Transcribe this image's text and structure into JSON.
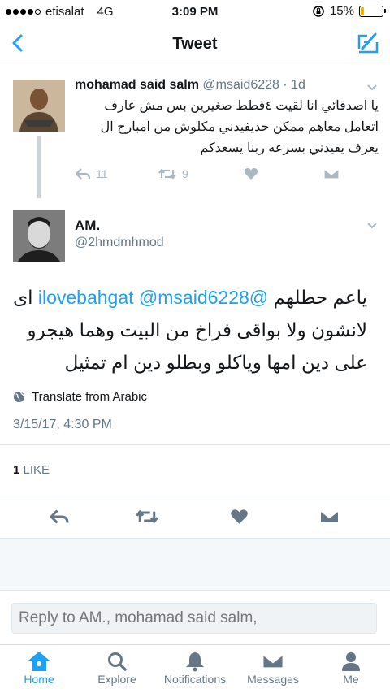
{
  "status_bar": {
    "carrier": "etisalat",
    "network": "4G",
    "time": "3:09 PM",
    "battery": "15%",
    "battery_level": 0.15
  },
  "nav": {
    "title": "Tweet",
    "back_icon": "chevron-left-icon",
    "compose_icon": "compose-icon"
  },
  "parent_tweet": {
    "name": "mohamad said salm",
    "handle": "@msaid6228 · 1d",
    "text": "يا اصدقائي انا لقيت ٤قطط صغيرين بس مش عارف اتعامل معاهم ممكن حديفيدني مكلوش من امبارح ال يعرف يفيدني بسرعه ربنا يسعدكم",
    "reply_count": "11",
    "retweet_count": "9"
  },
  "main_tweet": {
    "name": "AM.",
    "handle": "@2hmdmhmod",
    "mention1": "@msaid6228",
    "mention2": "@ilovebahgat",
    "text_lead": "ياعم حطلهم",
    "text_rest": "اى لانشون ولا بواقى فراخ من البيت وهما هيجرو على دين امها وياكلو وبطلو دين ام تمثيل",
    "translate": "Translate from Arabic",
    "timestamp": "3/15/17, 4:30 PM",
    "like_count": "1",
    "like_label": "LIKE"
  },
  "reply": {
    "placeholder": "Reply to AM., mohamad said salm,"
  },
  "tabs": [
    {
      "label": "Home",
      "icon": "home-icon"
    },
    {
      "label": "Explore",
      "icon": "search-icon"
    },
    {
      "label": "Notifications",
      "icon": "bell-icon"
    },
    {
      "label": "Messages",
      "icon": "envelope-icon"
    },
    {
      "label": "Me",
      "icon": "person-icon"
    }
  ],
  "colors": {
    "accent": "#1da1f2",
    "muted": "#657786",
    "battery": "#f2b400"
  }
}
